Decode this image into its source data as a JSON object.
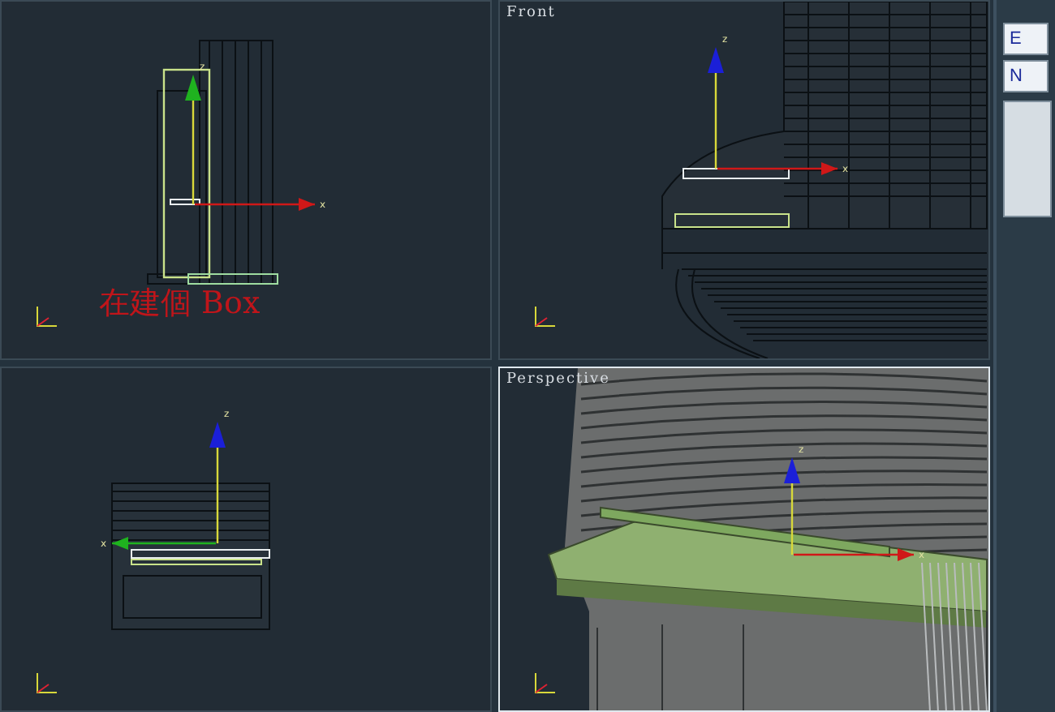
{
  "viewports": [
    {
      "kind": "left",
      "active": false,
      "gizmo": {
        "up": "z",
        "side": "x"
      },
      "annotation": "在建個 Box"
    },
    {
      "kind": "front",
      "label": "Front",
      "active": false,
      "gizmo": {
        "up": "z",
        "side": "x"
      }
    },
    {
      "kind": "top",
      "active": false,
      "gizmo": {
        "up": "z",
        "side": "x"
      }
    },
    {
      "kind": "perspective",
      "label": "Perspective",
      "active": true,
      "gizmo": {
        "up": "z",
        "side": "x"
      }
    }
  ],
  "command_panel": {
    "buttons": [
      "E",
      "N"
    ]
  }
}
